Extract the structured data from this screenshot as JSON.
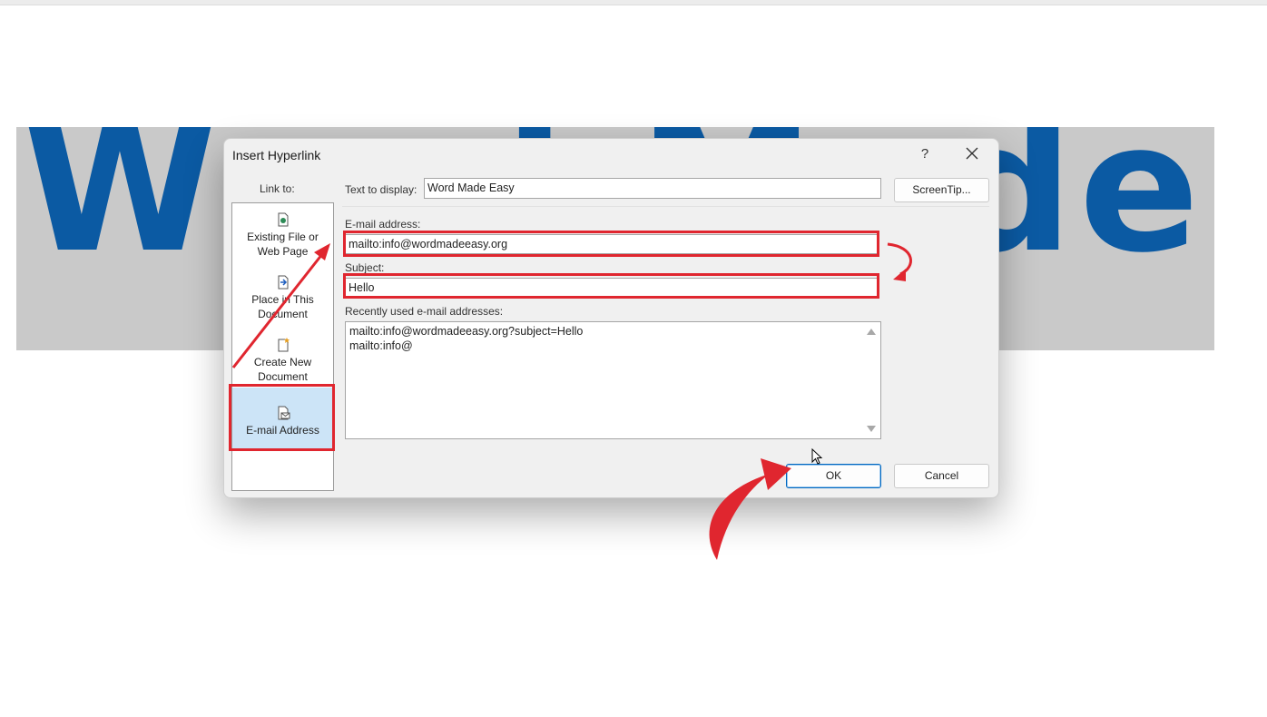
{
  "banner": {
    "text": "Word Made Easy"
  },
  "dialog": {
    "title": "Insert Hyperlink",
    "help_label": "?",
    "link_to_label": "Link to:",
    "nav_items": [
      {
        "line1": "Existing File or",
        "line2": "Web Page",
        "icon": "web-page-icon"
      },
      {
        "line1": "Place in This",
        "line2": "Document",
        "icon": "document-place-icon"
      },
      {
        "line1": "Create New",
        "line2": "Document",
        "icon": "new-document-icon"
      },
      {
        "line1": "E-mail Address",
        "line2": "",
        "icon": "email-icon",
        "selected": true
      }
    ],
    "text_to_display_label": "Text to display:",
    "text_to_display_value": "Word Made Easy",
    "screentip_label": "ScreenTip...",
    "email_label": "E-mail address:",
    "email_value": "mailto:info@wordmadeeasy.org",
    "subject_label": "Subject:",
    "subject_value": "Hello",
    "recent_label": "Recently used e-mail addresses:",
    "recent_items": [
      "mailto:info@wordmadeeasy.org?subject=Hello",
      "mailto:info@"
    ],
    "ok_label": "OK",
    "cancel_label": "Cancel"
  },
  "colors": {
    "banner_bg": "#c9c9c9",
    "banner_text": "#0b5aa3",
    "highlight": "#e0262f",
    "selected_nav": "#cce4f7"
  }
}
